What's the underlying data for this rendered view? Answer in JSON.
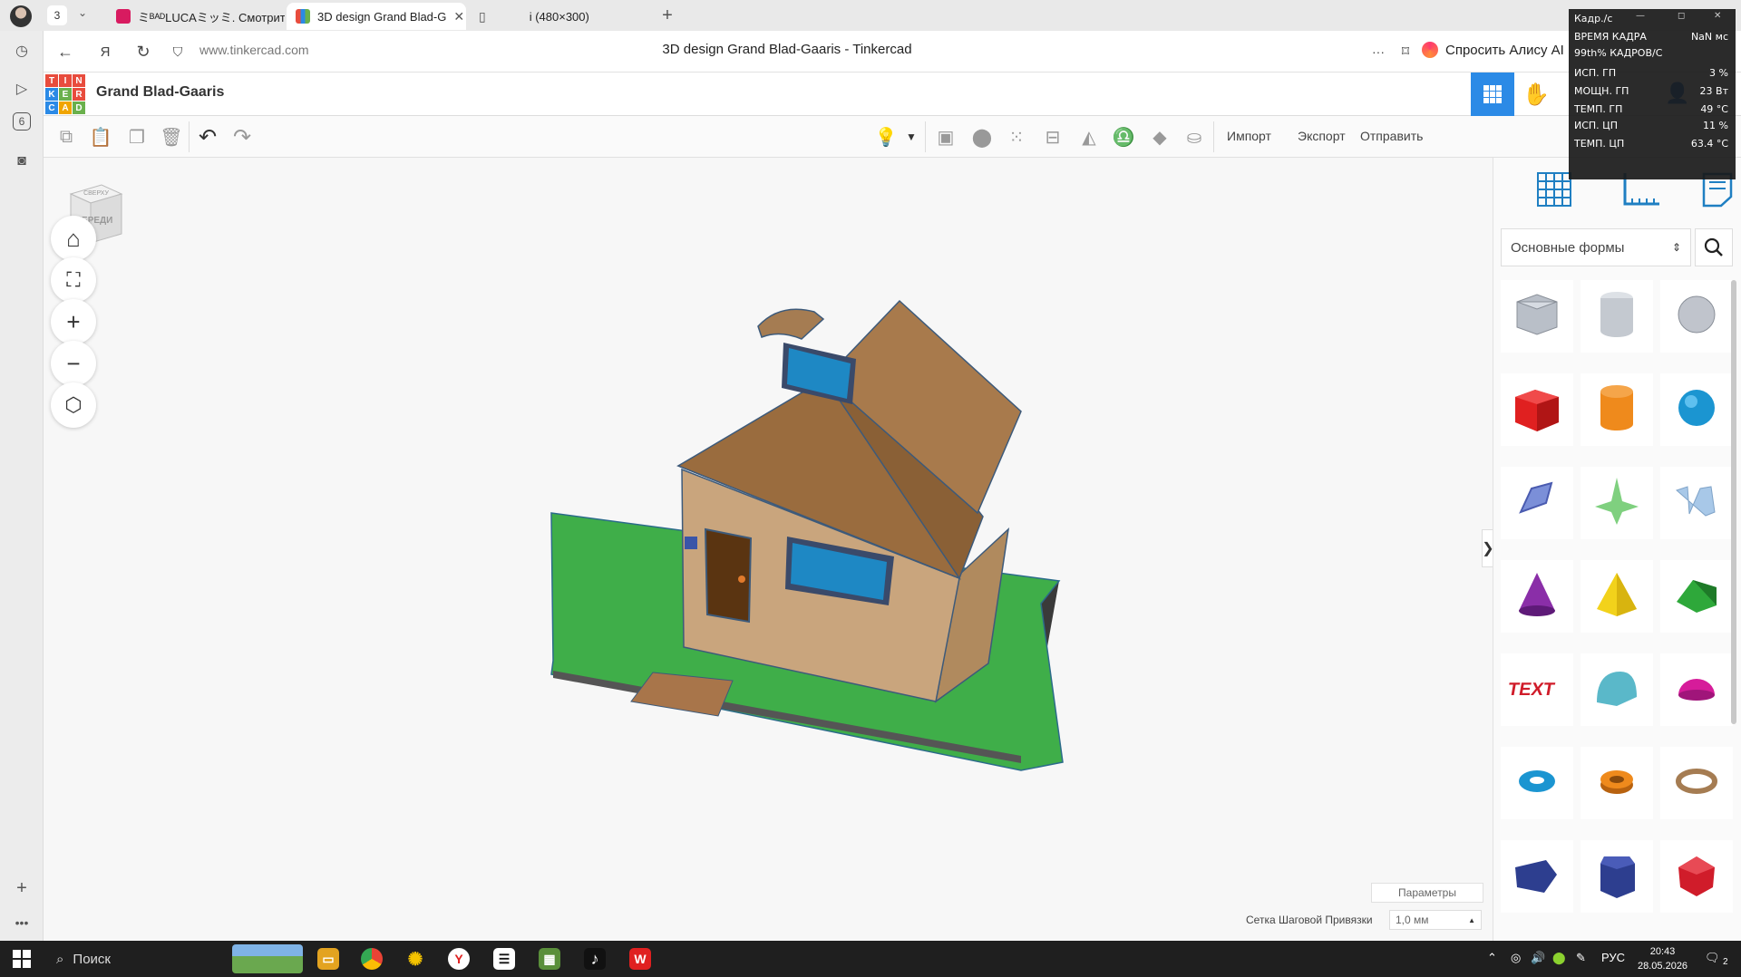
{
  "browser": {
    "tab_count": "3",
    "tabs": [
      {
        "label": "ミᴮᴬᴰLUCAミッミ. Смотрит",
        "favicon_color": "#d81b60"
      },
      {
        "label": "3D design Grand Blad-G",
        "favicon_color": "#2b8ae6",
        "close": "✕"
      },
      {
        "label": "i (480×300)",
        "favicon_color": "#ffffff"
      }
    ],
    "new_tab": "+",
    "url": "www.tinkercad.com",
    "page_title": "3D design Grand Blad-Gaaris - Tinkercad",
    "alice_label": "Спросить Алису AI",
    "left_rail_badge": "6"
  },
  "tinkercad": {
    "logo_letters": [
      "T",
      "I",
      "N",
      "K",
      "E",
      "R",
      "C",
      "A",
      "D"
    ],
    "logo_colors": [
      "#e84c3d",
      "#e84c3d",
      "#e84c3d",
      "#2b8ae6",
      "#6ab04c",
      "#e84c3d",
      "#2b8ae6",
      "#f0a500",
      "#6ab04c"
    ],
    "design_name": "Grand Blad-Gaaris",
    "toolbar": {
      "import_label": "Импорт",
      "export_label": "Экспорт",
      "send_label": "Отправить"
    },
    "viewcube": {
      "top": "СВЕРХУ",
      "front": "СПЕРЕДИ"
    },
    "view_controls": [
      "home-icon",
      "fit-view-icon",
      "zoom-in-icon",
      "zoom-out-icon",
      "perspective-icon"
    ],
    "params_label": "Параметры",
    "snap_label": "Сетка Шаговой Привязки",
    "snap_value": "1,0 мм",
    "shapes_category": "Основные формы",
    "shapes": [
      {
        "name": "box-hole",
        "color": "#b9bfc8"
      },
      {
        "name": "cylinder-hole",
        "color": "#c4c9d0"
      },
      {
        "name": "sphere-hole",
        "color": "#c0c4cc"
      },
      {
        "name": "box",
        "color": "#e02020"
      },
      {
        "name": "cylinder",
        "color": "#ef8a1c"
      },
      {
        "name": "sphere",
        "color": "#1b95d1"
      },
      {
        "name": "scribble",
        "color": "#7b8fd8"
      },
      {
        "name": "shape-generator",
        "color": "#7fd07f"
      },
      {
        "name": "text-3d",
        "color": "#a8c8e8"
      },
      {
        "name": "cone",
        "color": "#8a2ea8"
      },
      {
        "name": "pyramid",
        "color": "#f2d21b"
      },
      {
        "name": "roof",
        "color": "#2ea83a"
      },
      {
        "name": "text",
        "color": "#d01c2a"
      },
      {
        "name": "round-roof",
        "color": "#5ab8c9"
      },
      {
        "name": "half-sphere",
        "color": "#d61c9a"
      },
      {
        "name": "torus",
        "color": "#1b95d1"
      },
      {
        "name": "tube",
        "color": "#ef8a1c"
      },
      {
        "name": "ring",
        "color": "#a57c52"
      },
      {
        "name": "wedge-polygon",
        "color": "#2d3e8f"
      },
      {
        "name": "hexagonal-prism",
        "color": "#2d3e8f"
      },
      {
        "name": "icosahedron",
        "color": "#d01c2a"
      }
    ]
  },
  "perf_overlay": {
    "title": "Кадр./с",
    "rows": [
      {
        "label": "ВРЕМЯ КАДРА",
        "value": "NaN мс"
      },
      {
        "label": "99th% КАДРОВ/С",
        "value": ""
      },
      {
        "label": "ИСП. ГП",
        "value": "3 %"
      },
      {
        "label": "МОЩН. ГП",
        "value": "23 Вт"
      },
      {
        "label": "ТЕМП. ГП",
        "value": "49 °C"
      },
      {
        "label": "ИСП. ЦП",
        "value": "11 %"
      },
      {
        "label": "ТЕМП. ЦП",
        "value": "63.4 °C"
      }
    ]
  },
  "taskbar": {
    "search_label": "Поиск",
    "language": "РУС",
    "time": "20:43",
    "date": "28.05.2026",
    "notification_count": "2"
  }
}
